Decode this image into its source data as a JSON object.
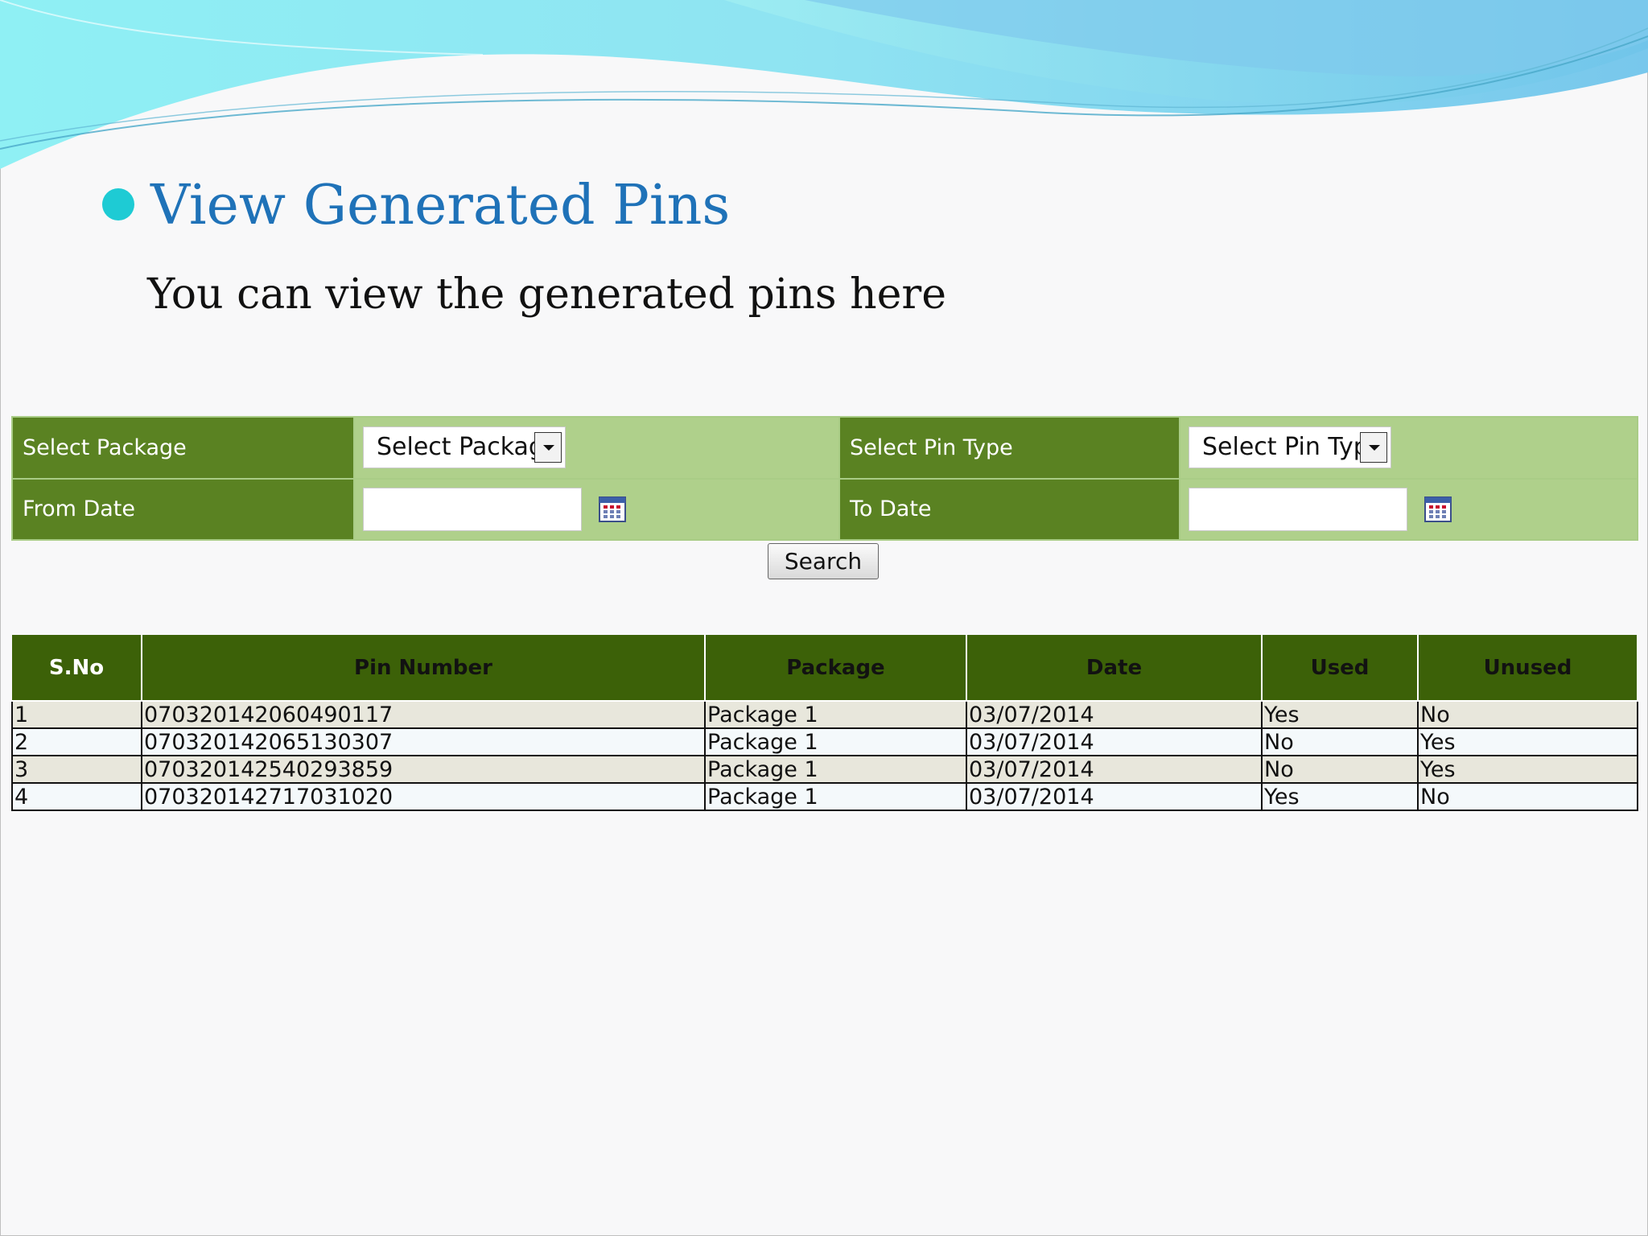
{
  "slide": {
    "title": "View Generated Pins",
    "subtitle": "You can view the generated pins here"
  },
  "search_form": {
    "package_label": "Select Package",
    "package_value": "Select Package",
    "pin_type_label": "Select Pin Type",
    "pin_type_value": "Select Pin Type",
    "from_date_label": "From Date",
    "from_date_value": "",
    "to_date_label": "To Date",
    "to_date_value": "",
    "search_button": "Search"
  },
  "results": {
    "columns": [
      "S.No",
      "Pin Number",
      "Package",
      "Date",
      "Used",
      "Unused"
    ],
    "rows": [
      [
        "1",
        "070320142060490117",
        "Package 1",
        "03/07/2014",
        "Yes",
        "No"
      ],
      [
        "2",
        "070320142065130307",
        "Package 1",
        "03/07/2014",
        "No",
        "Yes"
      ],
      [
        "3",
        "070320142540293859",
        "Package 1",
        "03/07/2014",
        "No",
        "Yes"
      ],
      [
        "4",
        "070320142717031020",
        "Package 1",
        "03/07/2014",
        "Yes",
        "No"
      ]
    ]
  },
  "colors": {
    "title": "#1f72b8",
    "bullet": "#1ecbd4",
    "label_bg": "#5a8222",
    "value_bg": "#afd08b",
    "header_bg": "#3c6108",
    "row_odd": "#e8e7dc",
    "row_even": "#f4f9fb"
  },
  "icons": {
    "bullet": "bullet-icon",
    "calendar": "calendar-icon",
    "dropdown": "chevron-down-icon"
  }
}
